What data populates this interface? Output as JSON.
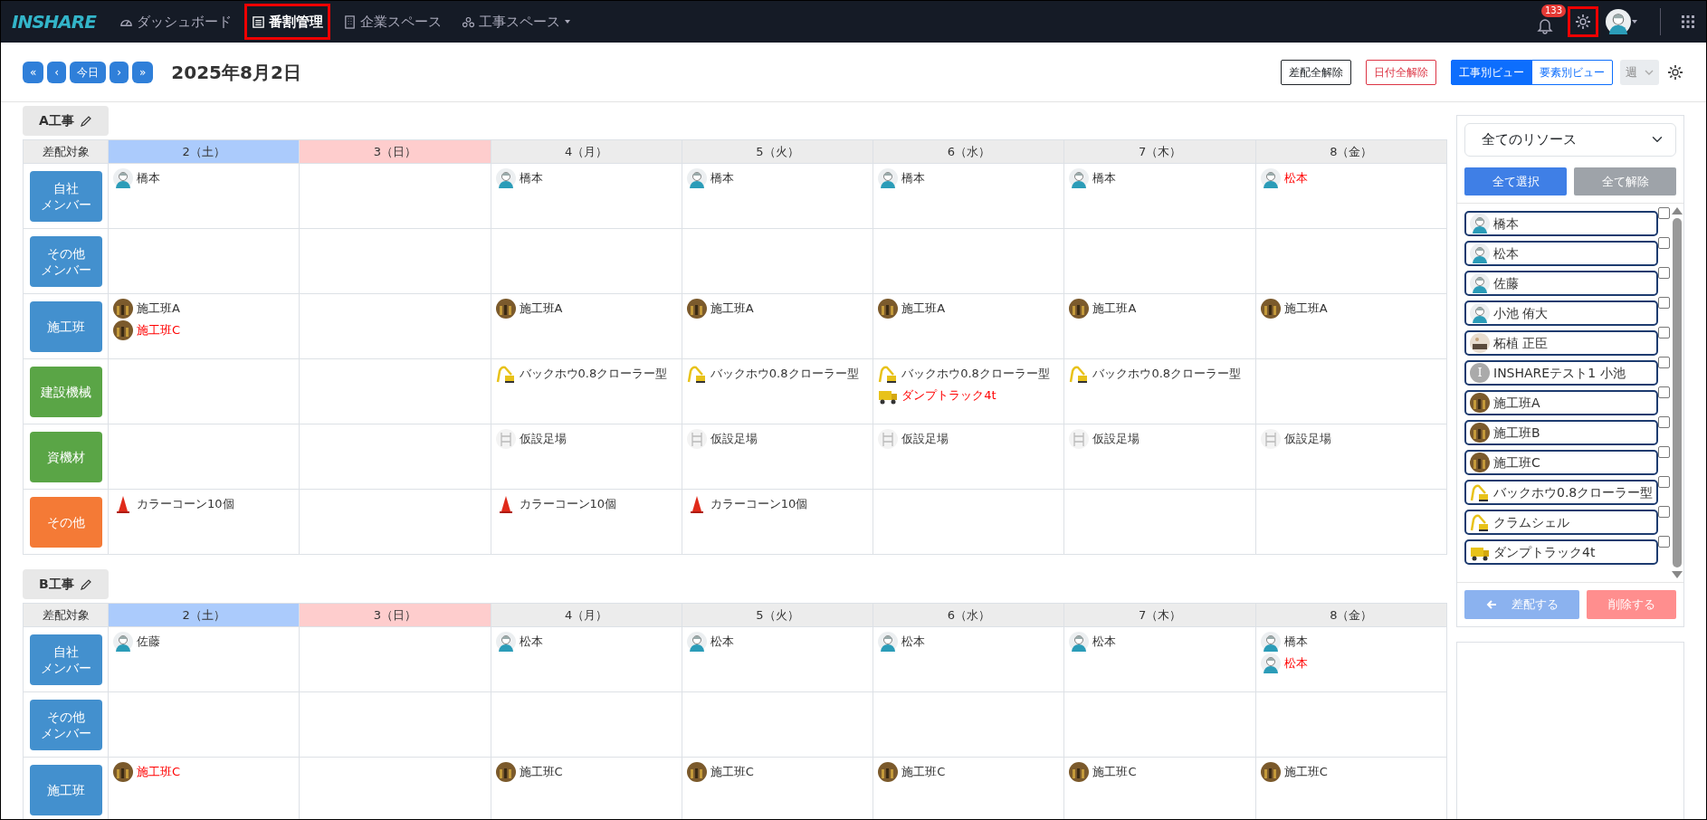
{
  "navbar": {
    "logo": "INSHARE",
    "items": [
      {
        "label": "ダッシュボード",
        "selected": false,
        "highlighted": false,
        "dropdown": false
      },
      {
        "label": "番割管理",
        "selected": true,
        "highlighted": true,
        "dropdown": false
      },
      {
        "label": "企業スペース",
        "selected": false,
        "highlighted": false,
        "dropdown": false
      },
      {
        "label": "工事スペース",
        "selected": false,
        "highlighted": false,
        "dropdown": true
      }
    ],
    "notification_count": "133",
    "settings_highlighted": true
  },
  "toolbar": {
    "nav_buttons": [
      "«",
      "‹",
      "今日",
      "›",
      "»"
    ],
    "date": "2025年8月2日",
    "clear_assignments": "差配全解除",
    "clear_dates": "日付全解除",
    "views": [
      {
        "label": "工事別ビュー",
        "selected": true
      },
      {
        "label": "要素別ビュー",
        "selected": false
      }
    ],
    "period": "週"
  },
  "projects": [
    {
      "name": "A工事",
      "corner": "差配対象",
      "days": [
        {
          "label": "2（土）",
          "kind": "saturday"
        },
        {
          "label": "3（日）",
          "kind": "sunday"
        },
        {
          "label": "4（月）",
          "kind": "weekday"
        },
        {
          "label": "5（火）",
          "kind": "weekday"
        },
        {
          "label": "6（水）",
          "kind": "weekday"
        },
        {
          "label": "7（木）",
          "kind": "weekday"
        },
        {
          "label": "8（金）",
          "kind": "weekday"
        }
      ],
      "rows": [
        {
          "label": [
            "自社",
            "メンバー"
          ],
          "color": "#4390ce",
          "cells": [
            [
              {
                "name": "橋本",
                "kind": "worker",
                "alert": false
              }
            ],
            [],
            [
              {
                "name": "橋本",
                "kind": "worker",
                "alert": false
              }
            ],
            [
              {
                "name": "橋本",
                "kind": "worker",
                "alert": false
              }
            ],
            [
              {
                "name": "橋本",
                "kind": "worker",
                "alert": false
              }
            ],
            [
              {
                "name": "橋本",
                "kind": "worker",
                "alert": false
              }
            ],
            [
              {
                "name": "松本",
                "kind": "worker",
                "alert": true
              }
            ]
          ]
        },
        {
          "label": [
            "その他",
            "メンバー"
          ],
          "color": "#4390ce",
          "cells": [
            [],
            [],
            [],
            [],
            [],
            [],
            []
          ]
        },
        {
          "label": [
            "施工班"
          ],
          "color": "#4390ce",
          "cells": [
            [
              {
                "name": "施工班A",
                "kind": "crew",
                "alert": false
              },
              {
                "name": "施工班C",
                "kind": "crew",
                "alert": true
              }
            ],
            [],
            [
              {
                "name": "施工班A",
                "kind": "crew",
                "alert": false
              }
            ],
            [
              {
                "name": "施工班A",
                "kind": "crew",
                "alert": false
              }
            ],
            [
              {
                "name": "施工班A",
                "kind": "crew",
                "alert": false
              }
            ],
            [
              {
                "name": "施工班A",
                "kind": "crew",
                "alert": false
              }
            ],
            [
              {
                "name": "施工班A",
                "kind": "crew",
                "alert": false
              }
            ]
          ]
        },
        {
          "label": [
            "建設機械"
          ],
          "color": "#5aa546",
          "cells": [
            [],
            [],
            [
              {
                "name": "バックホウ0.8クローラー型",
                "kind": "excavator",
                "alert": false
              }
            ],
            [
              {
                "name": "バックホウ0.8クローラー型",
                "kind": "excavator",
                "alert": false
              }
            ],
            [
              {
                "name": "バックホウ0.8クローラー型",
                "kind": "excavator",
                "alert": false
              },
              {
                "name": "ダンプトラック4t",
                "kind": "truck",
                "alert": true
              }
            ],
            [
              {
                "name": "バックホウ0.8クローラー型",
                "kind": "excavator",
                "alert": false
              }
            ],
            []
          ]
        },
        {
          "label": [
            "資機材"
          ],
          "color": "#5aa546",
          "cells": [
            [],
            [],
            [
              {
                "name": "仮設足場",
                "kind": "scaffold",
                "alert": false
              }
            ],
            [
              {
                "name": "仮設足場",
                "kind": "scaffold",
                "alert": false
              }
            ],
            [
              {
                "name": "仮設足場",
                "kind": "scaffold",
                "alert": false
              }
            ],
            [
              {
                "name": "仮設足場",
                "kind": "scaffold",
                "alert": false
              }
            ],
            [
              {
                "name": "仮設足場",
                "kind": "scaffold",
                "alert": false
              }
            ]
          ]
        },
        {
          "label": [
            "その他"
          ],
          "color": "#f47a36",
          "cells": [
            [
              {
                "name": "カラーコーン10個",
                "kind": "cone",
                "alert": false
              }
            ],
            [],
            [
              {
                "name": "カラーコーン10個",
                "kind": "cone",
                "alert": false
              }
            ],
            [
              {
                "name": "カラーコーン10個",
                "kind": "cone",
                "alert": false
              }
            ],
            [],
            [],
            []
          ]
        }
      ]
    },
    {
      "name": "B工事",
      "corner": "差配対象",
      "days": [
        {
          "label": "2（土）",
          "kind": "saturday"
        },
        {
          "label": "3（日）",
          "kind": "sunday"
        },
        {
          "label": "4（月）",
          "kind": "weekday"
        },
        {
          "label": "5（火）",
          "kind": "weekday"
        },
        {
          "label": "6（水）",
          "kind": "weekday"
        },
        {
          "label": "7（木）",
          "kind": "weekday"
        },
        {
          "label": "8（金）",
          "kind": "weekday"
        }
      ],
      "rows": [
        {
          "label": [
            "自社",
            "メンバー"
          ],
          "color": "#4390ce",
          "cells": [
            [
              {
                "name": "佐藤",
                "kind": "worker",
                "alert": false
              }
            ],
            [],
            [
              {
                "name": "松本",
                "kind": "worker",
                "alert": false
              }
            ],
            [
              {
                "name": "松本",
                "kind": "worker",
                "alert": false
              }
            ],
            [
              {
                "name": "松本",
                "kind": "worker",
                "alert": false
              }
            ],
            [
              {
                "name": "松本",
                "kind": "worker",
                "alert": false
              }
            ],
            [
              {
                "name": "橋本",
                "kind": "worker",
                "alert": false
              },
              {
                "name": "松本",
                "kind": "worker",
                "alert": true
              }
            ]
          ]
        },
        {
          "label": [
            "その他",
            "メンバー"
          ],
          "color": "#4390ce",
          "cells": [
            [],
            [],
            [],
            [],
            [],
            [],
            []
          ]
        },
        {
          "label": [
            "施工班"
          ],
          "color": "#4390ce",
          "cells": [
            [
              {
                "name": "施工班C",
                "kind": "crew",
                "alert": true
              }
            ],
            [],
            [
              {
                "name": "施工班C",
                "kind": "crew",
                "alert": false
              }
            ],
            [
              {
                "name": "施工班C",
                "kind": "crew",
                "alert": false
              }
            ],
            [
              {
                "name": "施工班C",
                "kind": "crew",
                "alert": false
              }
            ],
            [
              {
                "name": "施工班C",
                "kind": "crew",
                "alert": false
              }
            ],
            [
              {
                "name": "施工班C",
                "kind": "crew",
                "alert": false
              }
            ]
          ]
        }
      ]
    }
  ],
  "resources": {
    "filter": "全てのリソース",
    "select_all": "全て選択",
    "clear_all": "全て解除",
    "items": [
      {
        "name": "橋本",
        "kind": "worker",
        "checked": false
      },
      {
        "name": "松本",
        "kind": "worker",
        "checked": false
      },
      {
        "name": "佐藤",
        "kind": "worker",
        "checked": false
      },
      {
        "name": "小池 侑大",
        "kind": "worker",
        "checked": false
      },
      {
        "name": "柘植 正臣",
        "kind": "photo",
        "checked": false
      },
      {
        "name": "INSHAREテスト1 小池",
        "kind": "initial",
        "initial": "I",
        "checked": false
      },
      {
        "name": "施工班A",
        "kind": "crew",
        "checked": false
      },
      {
        "name": "施工班B",
        "kind": "crew",
        "checked": false
      },
      {
        "name": "施工班C",
        "kind": "crew",
        "checked": false
      },
      {
        "name": "バックホウ0.8クローラー型",
        "kind": "excavator",
        "checked": false
      },
      {
        "name": "クラムシェル",
        "kind": "excavator",
        "checked": false
      },
      {
        "name": "ダンプトラック4t",
        "kind": "truck",
        "checked": false
      }
    ],
    "assign": {
      "label": "差配する",
      "disabled": true
    },
    "remove": {
      "label": "削除する",
      "disabled": true
    }
  }
}
